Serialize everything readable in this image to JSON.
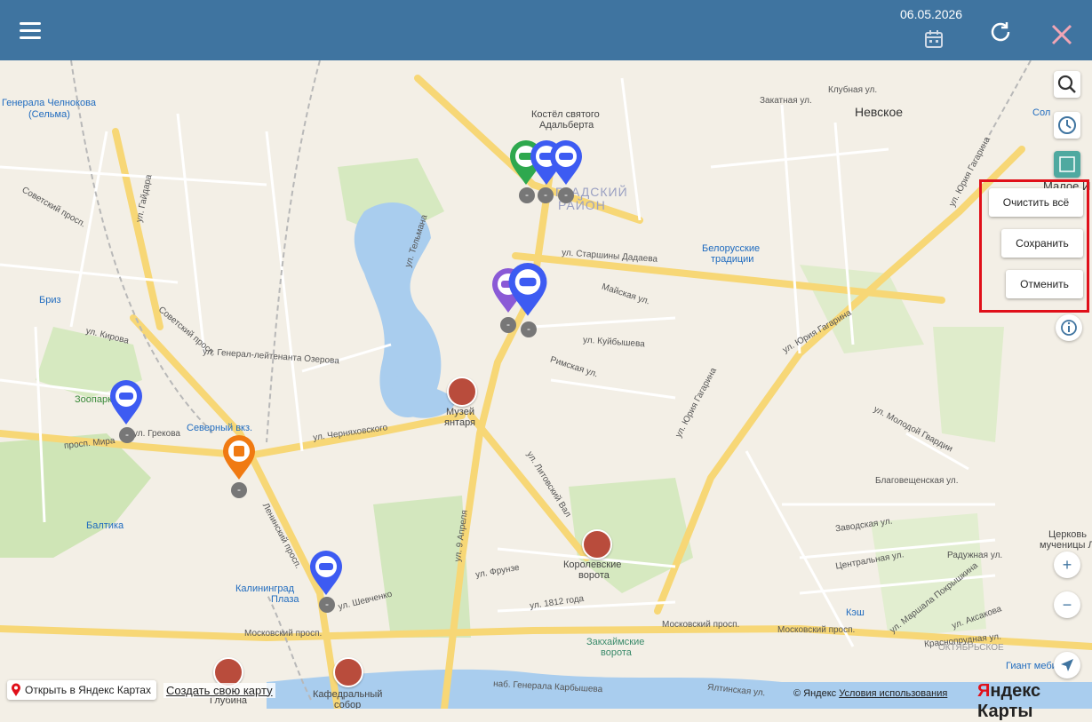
{
  "header": {
    "date": "06.05.2026",
    "menu_icon": "hamburger-icon",
    "calendar_icon": "calendar-icon",
    "refresh_icon": "refresh-icon",
    "close_icon": "close-icon"
  },
  "map": {
    "labels": {
      "nevskoe": "Невское",
      "district1": "ГРАДСКИЙ",
      "district2": "РАЙОН",
      "chelnokova": "Генерала Челнокова",
      "selma": "(Сельма)",
      "kostel": "Костёл святого",
      "adalberta": "Адальберта",
      "belorusskie": "Белорусские",
      "tradicii": "традиции",
      "briz": "Бриз",
      "zoopark": "Зоопарк",
      "severny": "Северный вкз.",
      "muzei": "Музей",
      "yantarya": "янтаря",
      "baltika": "Балтика",
      "kaliningrad_plaza": "Калининград",
      "plaza": "Плаза",
      "korolevskie": "Королевские",
      "vorota": "ворота",
      "zakhaimskie": "Закхаймские",
      "vorota2": "ворота",
      "kesh": "Кэш",
      "tserkov": "Церковь",
      "muchenitsy": "мученицы Ли",
      "giant": "Гиант меби",
      "kafedralny": "Кафедральный",
      "sobor": "собор",
      "glubina": "Глубина",
      "oktyabrskoe": "ОКТЯБРЬСКОЕ",
      "maloe": "Малое И",
      "sol": "Сол"
    },
    "streets": {
      "moskovsky": "Московский просп.",
      "moskovsky2": "Московский просп.",
      "moskovsky3": "Московский просп.",
      "chernyakhovskogo": "ул. Черняховского",
      "yuria_gagarina": "ул. Юрия Гагарина",
      "yuria_gagarina2": "ул. Юрия Гагарина",
      "yuria_gagarina3": "ул. Юрия Гагарина",
      "kuybysheva": "ул. Куйбышева",
      "sovetsky": "Советский просп.",
      "sovetsky2": "Советский просп.",
      "mira": "просп. Мира",
      "leninsky": "Ленинский просп.",
      "litovsky": "ул. Литовский Вал",
      "shevchenko": "ул. Шевченко",
      "frunze": "ул. Фрунзе",
      "gaidara": "ул. Гайдара",
      "tel": "ул. Тельмана",
      "ozerova": "ул. Генерал-лейтенанта Озерова",
      "kirova": "ул. Кирова",
      "greкова": "ул. Грекова",
      "9aprelya": "ул. 9 Апреля",
      "starshiny": "ул. Старшины Дадаева",
      "kalinina": "наб. Генерала Карбышева",
      "1812": "ул. 1812 года",
      "molodoy": "ул. Молодой Гвардии",
      "aksakova": "ул. Аксакова",
      "pokryshkina": "ул. Маршала Покрышкина",
      "klubnaya": "Клубная ул.",
      "zakatnaya": "Закатная ул.",
      "mayskaya": "Майская ул.",
      "rimskaya": "Римская ул.",
      "blagoveshchenskaya": "Благовещенская ул.",
      "zavodskaya": "Заводская ул.",
      "tsentralnaya": "Центральная ул.",
      "radujnaya": "Радужная ул.",
      "krasnopr": "Краснопрудная ул.",
      "yaltinskaya": "Ялтинская ул."
    }
  },
  "popup": {
    "clear_all": "Очистить всё",
    "save": "Сохранить",
    "cancel": "Отменить"
  },
  "controls": {
    "search_icon": "search-icon",
    "history_icon": "clock-icon",
    "layers_icon": "layers-icon",
    "info_icon": "info-icon",
    "zoom_in": "+",
    "zoom_out": "−",
    "locate_icon": "locate-icon"
  },
  "markers": {
    "minus_label": "-"
  },
  "footer": {
    "open_in_yandex": "Открыть в Яндекс Картах",
    "create_map": "Создать свою карту",
    "copyright": "© Яндекс",
    "terms": "Условия использования",
    "logo_ya": "Я",
    "logo_rest": "ндекс Карты"
  },
  "colors": {
    "header": "#3f74a0",
    "marker_blue": "#3d5bf2",
    "marker_green": "#2ea84e",
    "marker_purple": "#8a5ad6",
    "marker_orange": "#f07a12",
    "highlight": "#e0101a"
  }
}
